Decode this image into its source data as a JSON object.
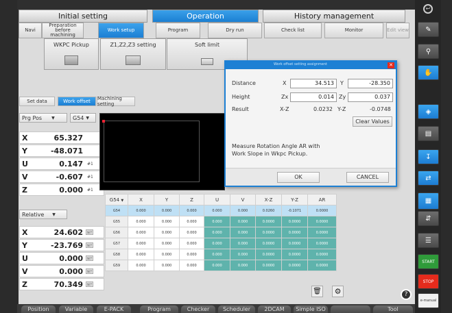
{
  "top_tabs": [
    "Initial setting",
    "Operation",
    "History management"
  ],
  "sub_tabs": [
    "Navi",
    "Preparation before machining",
    "Work setup",
    "Program",
    "Dry run",
    "Check list",
    "Monitor",
    "Edit view"
  ],
  "pickups": [
    {
      "label": "WKPC Pickup",
      "icon": "probe-block-icon"
    },
    {
      "label": "Z1,Z2,Z3 setting",
      "icon": "tool-length-icon"
    },
    {
      "label": "Soft limit",
      "icon": "soft-limit-icon"
    }
  ],
  "tool_buttons": [
    "Set data",
    "Work offset",
    "Machining setting"
  ],
  "pos_panel": {
    "mode": "Prg Pos",
    "coord": "G54",
    "rows": [
      {
        "axis": "X",
        "value": "65.327",
        "suffix": ""
      },
      {
        "axis": "Y",
        "value": "-48.071",
        "suffix": ""
      },
      {
        "axis": "U",
        "value": "0.147",
        "suffix": "#1"
      },
      {
        "axis": "V",
        "value": "-0.607",
        "suffix": "#1"
      },
      {
        "axis": "Z",
        "value": "0.000",
        "suffix": "#1"
      }
    ]
  },
  "rel_panel": {
    "mode": "Relative",
    "rows": [
      {
        "axis": "X",
        "value": "24.602",
        "btn": "SET"
      },
      {
        "axis": "Y",
        "value": "-23.769",
        "btn": "SET"
      },
      {
        "axis": "U",
        "value": "0.000",
        "btn": "SET"
      },
      {
        "axis": "V",
        "value": "0.000",
        "btn": "SET"
      },
      {
        "axis": "Z",
        "value": "70.349",
        "btn": "SET"
      }
    ]
  },
  "offset_table": {
    "selector": "G54",
    "headers": [
      "X",
      "Y",
      "Z",
      "U",
      "V",
      "X-Z",
      "Y-Z",
      "AR"
    ],
    "rows": [
      {
        "name": "G54",
        "cells": [
          "0.000",
          "0.000",
          "0.000",
          "0.000",
          "0.000",
          "0.0260",
          "-0.1071",
          "0.0000"
        ]
      },
      {
        "name": "G55",
        "cells": [
          "0.000",
          "0.000",
          "0.000",
          "0.000",
          "0.000",
          "0.0000",
          "0.0000",
          "0.0000"
        ]
      },
      {
        "name": "G56",
        "cells": [
          "0.000",
          "0.000",
          "0.000",
          "0.000",
          "0.000",
          "0.0000",
          "0.0000",
          "0.0000"
        ]
      },
      {
        "name": "G57",
        "cells": [
          "0.000",
          "0.000",
          "0.000",
          "0.000",
          "0.000",
          "0.0000",
          "0.0000",
          "0.0000"
        ]
      },
      {
        "name": "G58",
        "cells": [
          "0.000",
          "0.000",
          "0.000",
          "0.000",
          "0.000",
          "0.0000",
          "0.0000",
          "0.0000"
        ]
      },
      {
        "name": "G59",
        "cells": [
          "0.000",
          "0.000",
          "0.000",
          "0.000",
          "0.000",
          "0.0000",
          "0.0000",
          "0.0000"
        ]
      }
    ]
  },
  "dialog": {
    "title": "Work offset setting assignment",
    "distance_label": "Distance",
    "height_label": "Height",
    "result_label": "Result",
    "x_label": "X",
    "x_value": "34.513",
    "y_label": "Y",
    "y_value": "-28.350",
    "zx_label": "Zx",
    "zx_value": "0.014",
    "zy_label": "Zy",
    "zy_value": "0.037",
    "xz_label": "X-Z",
    "xz_value": "0.0232",
    "yz_label": "Y-Z",
    "yz_value": "-0.0748",
    "clear_label": "Clear Values",
    "message": "Measure Rotation Angle AR with Work Slope in Wkpc Pickup.",
    "ok_label": "OK",
    "cancel_label": "CANCEL"
  },
  "bottom_tabs": [
    "Position",
    "Variable",
    "E-PACK",
    "Program",
    "Checker",
    "Scheduler",
    "2DCAM",
    "Simple ISO",
    "",
    "Tool"
  ],
  "side_buttons": [
    {
      "icon": "back-icon",
      "label": ""
    },
    {
      "icon": "edit-icon",
      "label": ""
    },
    {
      "icon": "key-icon",
      "label": ""
    },
    {
      "icon": "hand-icon",
      "label": ""
    },
    {
      "icon": "align-icon",
      "label": ""
    },
    {
      "icon": "wire-icon",
      "label": ""
    },
    {
      "icon": "down-arrow-icon",
      "label": ""
    },
    {
      "icon": "move-icon",
      "label": ""
    },
    {
      "icon": "calc-icon",
      "label": ""
    },
    {
      "icon": "jog-icon",
      "label": ""
    },
    {
      "icon": "split-icon",
      "label": ""
    },
    {
      "icon": "",
      "label": "START"
    },
    {
      "icon": "",
      "label": "STOP"
    },
    {
      "icon": "",
      "label": "e-manual"
    }
  ],
  "colors": {
    "accent": "#1d80d4",
    "teal": "#5fb3ac",
    "start": "#2f9b3a",
    "stop": "#e52b1c"
  }
}
